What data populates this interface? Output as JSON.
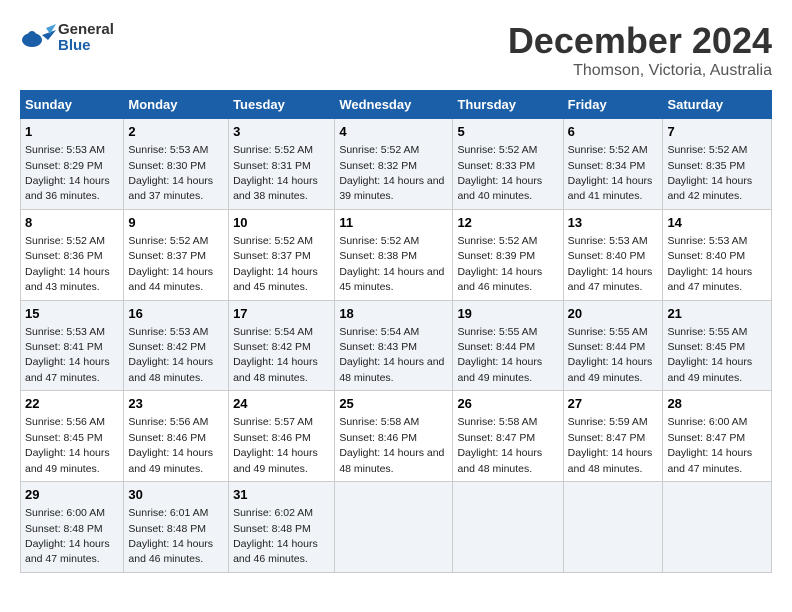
{
  "logo": {
    "line1": "General",
    "line2": "Blue"
  },
  "title": "December 2024",
  "subtitle": "Thomson, Victoria, Australia",
  "headers": [
    "Sunday",
    "Monday",
    "Tuesday",
    "Wednesday",
    "Thursday",
    "Friday",
    "Saturday"
  ],
  "weeks": [
    [
      {
        "day": "1",
        "sunrise": "Sunrise: 5:53 AM",
        "sunset": "Sunset: 8:29 PM",
        "daylight": "Daylight: 14 hours and 36 minutes."
      },
      {
        "day": "2",
        "sunrise": "Sunrise: 5:53 AM",
        "sunset": "Sunset: 8:30 PM",
        "daylight": "Daylight: 14 hours and 37 minutes."
      },
      {
        "day": "3",
        "sunrise": "Sunrise: 5:52 AM",
        "sunset": "Sunset: 8:31 PM",
        "daylight": "Daylight: 14 hours and 38 minutes."
      },
      {
        "day": "4",
        "sunrise": "Sunrise: 5:52 AM",
        "sunset": "Sunset: 8:32 PM",
        "daylight": "Daylight: 14 hours and 39 minutes."
      },
      {
        "day": "5",
        "sunrise": "Sunrise: 5:52 AM",
        "sunset": "Sunset: 8:33 PM",
        "daylight": "Daylight: 14 hours and 40 minutes."
      },
      {
        "day": "6",
        "sunrise": "Sunrise: 5:52 AM",
        "sunset": "Sunset: 8:34 PM",
        "daylight": "Daylight: 14 hours and 41 minutes."
      },
      {
        "day": "7",
        "sunrise": "Sunrise: 5:52 AM",
        "sunset": "Sunset: 8:35 PM",
        "daylight": "Daylight: 14 hours and 42 minutes."
      }
    ],
    [
      {
        "day": "8",
        "sunrise": "Sunrise: 5:52 AM",
        "sunset": "Sunset: 8:36 PM",
        "daylight": "Daylight: 14 hours and 43 minutes."
      },
      {
        "day": "9",
        "sunrise": "Sunrise: 5:52 AM",
        "sunset": "Sunset: 8:37 PM",
        "daylight": "Daylight: 14 hours and 44 minutes."
      },
      {
        "day": "10",
        "sunrise": "Sunrise: 5:52 AM",
        "sunset": "Sunset: 8:37 PM",
        "daylight": "Daylight: 14 hours and 45 minutes."
      },
      {
        "day": "11",
        "sunrise": "Sunrise: 5:52 AM",
        "sunset": "Sunset: 8:38 PM",
        "daylight": "Daylight: 14 hours and 45 minutes."
      },
      {
        "day": "12",
        "sunrise": "Sunrise: 5:52 AM",
        "sunset": "Sunset: 8:39 PM",
        "daylight": "Daylight: 14 hours and 46 minutes."
      },
      {
        "day": "13",
        "sunrise": "Sunrise: 5:53 AM",
        "sunset": "Sunset: 8:40 PM",
        "daylight": "Daylight: 14 hours and 47 minutes."
      },
      {
        "day": "14",
        "sunrise": "Sunrise: 5:53 AM",
        "sunset": "Sunset: 8:40 PM",
        "daylight": "Daylight: 14 hours and 47 minutes."
      }
    ],
    [
      {
        "day": "15",
        "sunrise": "Sunrise: 5:53 AM",
        "sunset": "Sunset: 8:41 PM",
        "daylight": "Daylight: 14 hours and 47 minutes."
      },
      {
        "day": "16",
        "sunrise": "Sunrise: 5:53 AM",
        "sunset": "Sunset: 8:42 PM",
        "daylight": "Daylight: 14 hours and 48 minutes."
      },
      {
        "day": "17",
        "sunrise": "Sunrise: 5:54 AM",
        "sunset": "Sunset: 8:42 PM",
        "daylight": "Daylight: 14 hours and 48 minutes."
      },
      {
        "day": "18",
        "sunrise": "Sunrise: 5:54 AM",
        "sunset": "Sunset: 8:43 PM",
        "daylight": "Daylight: 14 hours and 48 minutes."
      },
      {
        "day": "19",
        "sunrise": "Sunrise: 5:55 AM",
        "sunset": "Sunset: 8:44 PM",
        "daylight": "Daylight: 14 hours and 49 minutes."
      },
      {
        "day": "20",
        "sunrise": "Sunrise: 5:55 AM",
        "sunset": "Sunset: 8:44 PM",
        "daylight": "Daylight: 14 hours and 49 minutes."
      },
      {
        "day": "21",
        "sunrise": "Sunrise: 5:55 AM",
        "sunset": "Sunset: 8:45 PM",
        "daylight": "Daylight: 14 hours and 49 minutes."
      }
    ],
    [
      {
        "day": "22",
        "sunrise": "Sunrise: 5:56 AM",
        "sunset": "Sunset: 8:45 PM",
        "daylight": "Daylight: 14 hours and 49 minutes."
      },
      {
        "day": "23",
        "sunrise": "Sunrise: 5:56 AM",
        "sunset": "Sunset: 8:46 PM",
        "daylight": "Daylight: 14 hours and 49 minutes."
      },
      {
        "day": "24",
        "sunrise": "Sunrise: 5:57 AM",
        "sunset": "Sunset: 8:46 PM",
        "daylight": "Daylight: 14 hours and 49 minutes."
      },
      {
        "day": "25",
        "sunrise": "Sunrise: 5:58 AM",
        "sunset": "Sunset: 8:46 PM",
        "daylight": "Daylight: 14 hours and 48 minutes."
      },
      {
        "day": "26",
        "sunrise": "Sunrise: 5:58 AM",
        "sunset": "Sunset: 8:47 PM",
        "daylight": "Daylight: 14 hours and 48 minutes."
      },
      {
        "day": "27",
        "sunrise": "Sunrise: 5:59 AM",
        "sunset": "Sunset: 8:47 PM",
        "daylight": "Daylight: 14 hours and 48 minutes."
      },
      {
        "day": "28",
        "sunrise": "Sunrise: 6:00 AM",
        "sunset": "Sunset: 8:47 PM",
        "daylight": "Daylight: 14 hours and 47 minutes."
      }
    ],
    [
      {
        "day": "29",
        "sunrise": "Sunrise: 6:00 AM",
        "sunset": "Sunset: 8:48 PM",
        "daylight": "Daylight: 14 hours and 47 minutes."
      },
      {
        "day": "30",
        "sunrise": "Sunrise: 6:01 AM",
        "sunset": "Sunset: 8:48 PM",
        "daylight": "Daylight: 14 hours and 46 minutes."
      },
      {
        "day": "31",
        "sunrise": "Sunrise: 6:02 AM",
        "sunset": "Sunset: 8:48 PM",
        "daylight": "Daylight: 14 hours and 46 minutes."
      },
      {
        "day": "",
        "sunrise": "",
        "sunset": "",
        "daylight": ""
      },
      {
        "day": "",
        "sunrise": "",
        "sunset": "",
        "daylight": ""
      },
      {
        "day": "",
        "sunrise": "",
        "sunset": "",
        "daylight": ""
      },
      {
        "day": "",
        "sunrise": "",
        "sunset": "",
        "daylight": ""
      }
    ]
  ]
}
